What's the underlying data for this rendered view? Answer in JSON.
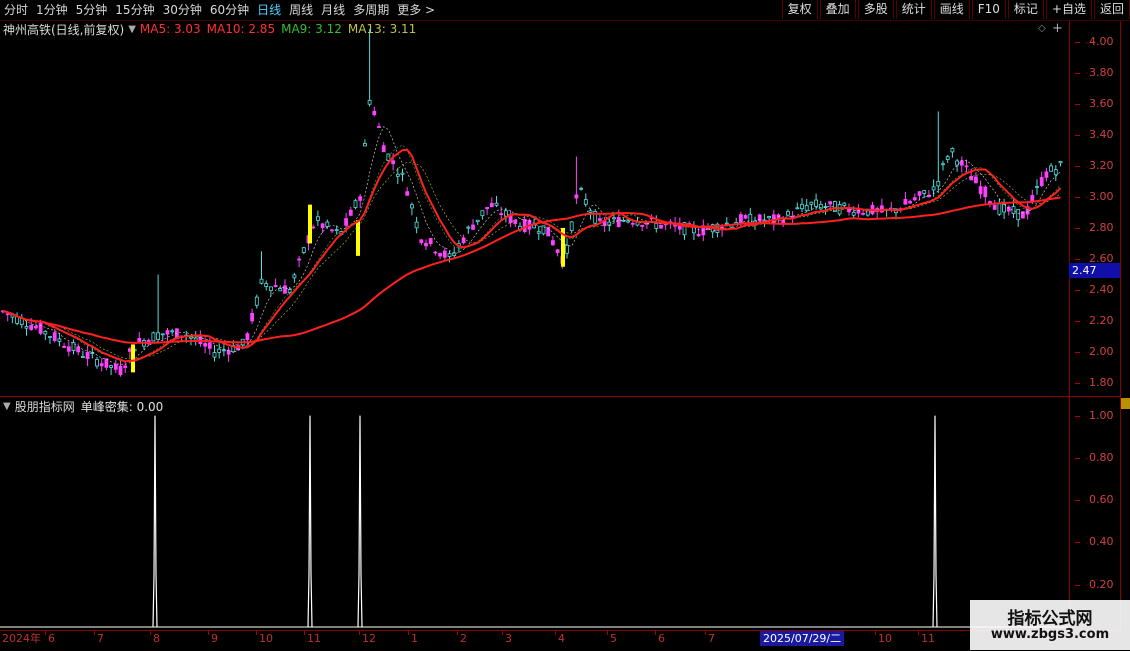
{
  "toolbar": {
    "periods": [
      "分时",
      "1分钟",
      "5分钟",
      "15分钟",
      "30分钟",
      "60分钟",
      "日线",
      "周线",
      "月线",
      "多周期",
      "更多 >"
    ],
    "active_period": "日线",
    "right_buttons": [
      "复权",
      "叠加",
      "多股",
      "统计",
      "画线",
      "F10",
      "标记",
      "+自选",
      "返回"
    ]
  },
  "main_chart": {
    "title": "神州高铁(日线,前复权)",
    "ma": [
      {
        "label": "MA5: 3.03",
        "color": "#ff3030"
      },
      {
        "label": "MA10: 2.85",
        "color": "#ff3030"
      },
      {
        "label": "MA9: 3.12",
        "color": "#30c030"
      },
      {
        "label": "MA13: 3.11",
        "color": "#c0c040"
      }
    ],
    "current_price": "2.47",
    "y_labels": [
      "4.00",
      "3.80",
      "3.60",
      "3.40",
      "3.20",
      "3.00",
      "2.80",
      "2.60",
      "2.40",
      "2.20",
      "2.00",
      "1.80"
    ]
  },
  "indicator": {
    "title": "股朋指标网",
    "subtitle": "单峰密集: 0.00",
    "y_labels": [
      "1.00",
      "0.80",
      "0.60",
      "0.40",
      "0.20"
    ]
  },
  "x_axis": {
    "labels": [
      "2024年",
      "6",
      "7",
      "8",
      "9",
      "10",
      "11",
      "12",
      "1",
      "2",
      "3",
      "4",
      "5",
      "6",
      "7",
      "10",
      "11"
    ],
    "crosshair_date": "2025/07/29/二"
  },
  "watermark": {
    "line1": "指标公式网",
    "line2": "www.zbgs3.com"
  },
  "chart_data": [
    {
      "type": "candlestick",
      "title": "神州高铁(日线,前复权)",
      "ylim": [
        1.75,
        4.1
      ],
      "series": [
        {
          "name": "MA5",
          "value": 3.03
        },
        {
          "name": "MA10",
          "value": 2.85
        },
        {
          "name": "MA9",
          "value": 3.12
        },
        {
          "name": "MA13",
          "value": 3.11
        }
      ],
      "last_price": 2.47
    },
    {
      "type": "line",
      "title": "单峰密集",
      "ylim": [
        0,
        1.05
      ],
      "spikes_at_months": [
        "8",
        "11",
        "12",
        "11"
      ],
      "value": 0.0
    }
  ]
}
